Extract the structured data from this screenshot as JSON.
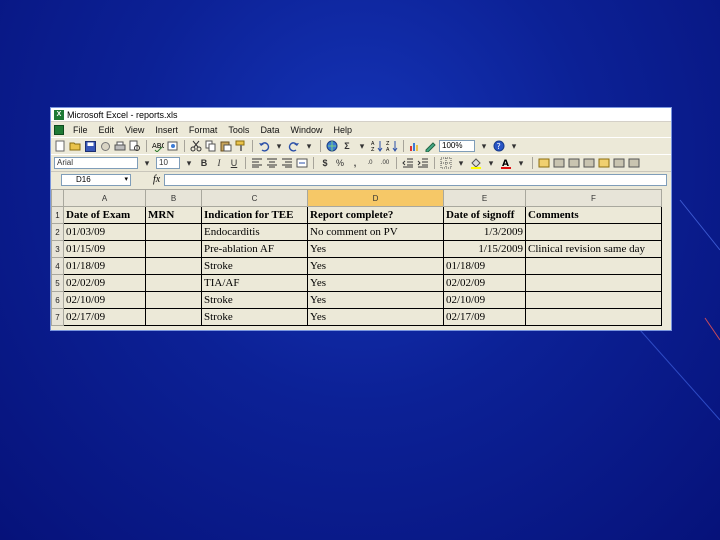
{
  "window": {
    "title": "Microsoft Excel - reports.xls",
    "app_icon": "X"
  },
  "menu": [
    "File",
    "Edit",
    "View",
    "Insert",
    "Format",
    "Tools",
    "Data",
    "Window",
    "Help"
  ],
  "toolbar": {
    "zoom": "100%",
    "font_name": "Arial",
    "font_size": "10",
    "sigma": "Σ"
  },
  "formula_bar": {
    "name_box": "D16",
    "fx_label": "fx",
    "formula": ""
  },
  "sheet": {
    "column_letters": [
      "A",
      "B",
      "C",
      "D",
      "E",
      "F"
    ],
    "active_column": "D",
    "header_row_number": "1",
    "headers": [
      "Date of Exam",
      "MRN",
      "Indication for TEE",
      "Report complete?",
      "Date of signoff",
      "Comments"
    ],
    "rows": [
      {
        "num": "2",
        "cells": [
          "01/03/09",
          "",
          "Endocarditis",
          "No comment on PV",
          "1/3/2009",
          ""
        ]
      },
      {
        "num": "3",
        "cells": [
          "01/15/09",
          "",
          "Pre-ablation AF",
          "Yes",
          "1/15/2009",
          "Clinical revision same day"
        ]
      },
      {
        "num": "4",
        "cells": [
          "01/18/09",
          "",
          "Stroke",
          "Yes",
          "01/18/09",
          ""
        ]
      },
      {
        "num": "5",
        "cells": [
          "02/02/09",
          "",
          "TIA/AF",
          "Yes",
          "02/02/09",
          ""
        ]
      },
      {
        "num": "6",
        "cells": [
          "02/10/09",
          "",
          "Stroke",
          "Yes",
          "02/10/09",
          ""
        ]
      },
      {
        "num": "7",
        "cells": [
          "02/17/09",
          "",
          "Stroke",
          "Yes",
          "02/17/09",
          ""
        ]
      }
    ]
  },
  "colors": {
    "background": "#0c2196",
    "active_column_header": "#f6c867",
    "app_icon": "#1f7a35"
  }
}
